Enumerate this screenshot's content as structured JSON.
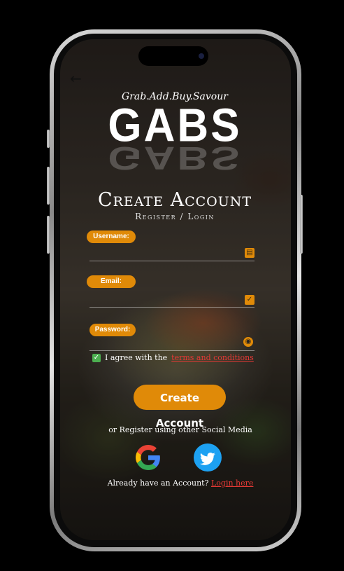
{
  "app": {
    "tagline": "Grab.Add.Buy.Savour",
    "logo": "GABS",
    "title": "Create Account",
    "subtitle": "Register / Login"
  },
  "form": {
    "username": {
      "label": "Username:",
      "value": "",
      "icon": "contact-card-icon"
    },
    "email": {
      "label": "Email:",
      "value": "",
      "icon": "check-square-icon"
    },
    "password": {
      "label": "Password:",
      "value": "",
      "icon": "eye-icon"
    }
  },
  "agree": {
    "checked": true,
    "text": "I agree with the",
    "link": "terms and conditions"
  },
  "cta_label": "Create Account",
  "social": {
    "label": "or Register using other Social Media",
    "providers": [
      "google-icon",
      "twitter-icon"
    ]
  },
  "login": {
    "text": "Already have an Account?",
    "link": "Login here"
  },
  "colors": {
    "accent": "#e08a08",
    "link": "#e53935",
    "check": "#4caf50",
    "twitter": "#1da1f2"
  }
}
